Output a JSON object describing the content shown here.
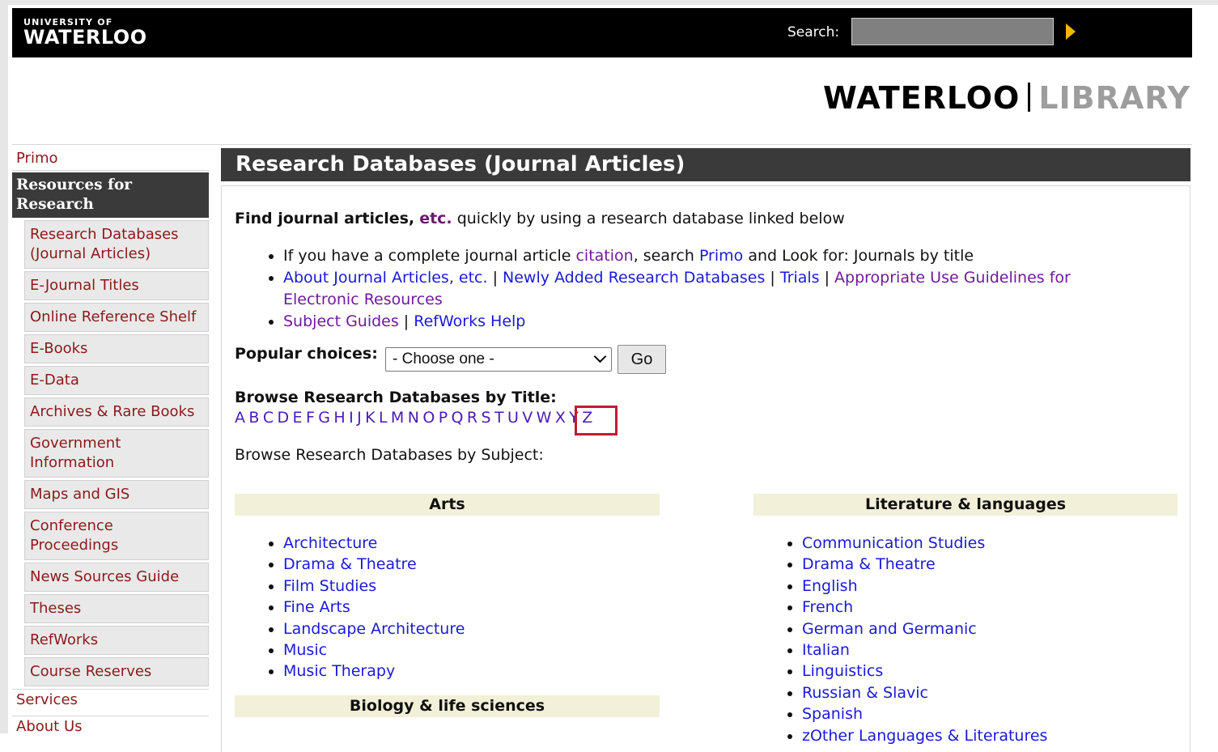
{
  "header": {
    "logo_small": "UNIVERSITY OF",
    "logo_big": "WATERLOO",
    "search_label": "Search:",
    "search_value": "",
    "brand_left": "WATERLOO",
    "brand_right": "LIBRARY"
  },
  "sidebar": {
    "top_link": "Primo",
    "current": "Resources for Research",
    "items": [
      "Research Databases (Journal Articles)",
      "E-Journal Titles",
      "Online Reference Shelf",
      "E-Books",
      "E-Data",
      "Archives & Rare Books",
      "Government Information",
      "Maps and GIS",
      "Conference Proceedings",
      "News Sources Guide",
      "Theses",
      "RefWorks",
      "Course Reserves"
    ],
    "bottom_links": [
      "Services",
      "About Us"
    ]
  },
  "main": {
    "title": "Research Databases (Journal Articles)",
    "intro_bold": "Find journal articles,",
    "intro_etc": "etc.",
    "intro_rest": " quickly by using a research database linked below",
    "bullet1": {
      "pre": "If you have a complete journal article ",
      "citation": "citation",
      "mid": ", search ",
      "primo": "Primo",
      "post": " and Look for: Journals by title"
    },
    "bullet2": {
      "about": "About Journal Articles, etc.",
      "sep": " | ",
      "newly": "Newly Added Research Databases",
      "trials": "Trials",
      "guidelines": "Appropriate Use Guidelines for Electronic Resources"
    },
    "bullet3": {
      "subject_guides": "Subject Guides",
      "sep": " | ",
      "refworks_help": "RefWorks Help"
    },
    "popular_label": "Popular choices:",
    "popular_selected": "- Choose one -",
    "go_label": "Go",
    "browse_title": "Browse Research Databases by Title:",
    "alphabet": [
      "A",
      "B",
      "C",
      "D",
      "E",
      "F",
      "G",
      "H",
      "I",
      "J",
      "K",
      "L",
      "M",
      "N",
      "O",
      "P",
      "Q",
      "R",
      "S",
      "T",
      "U",
      "V",
      "W",
      "X",
      "Y",
      "Z"
    ],
    "browse_subject": "Browse Research Databases by Subject:",
    "categories": {
      "arts": {
        "title": "Arts",
        "items": [
          "Architecture",
          "Drama & Theatre",
          "Film Studies",
          "Fine Arts",
          "Landscape Architecture",
          "Music",
          "Music Therapy"
        ]
      },
      "biology": {
        "title": "Biology & life sciences"
      },
      "literature": {
        "title": "Literature & languages",
        "items": [
          "Communication Studies",
          "Drama & Theatre",
          "English",
          "French",
          "German and Germanic",
          "Italian",
          "Linguistics",
          "Russian & Slavic",
          "Spanish",
          "zOther Languages & Literatures"
        ]
      }
    }
  },
  "colors": {
    "link": "#1a1ad9",
    "visited": "#6e1a9e",
    "sidebar_link": "#8b1a1a",
    "dark_bar": "#3a3a3a",
    "category_bg": "#f2f0d8",
    "highlight": "#c11b32",
    "search_arrow": "#f2b800"
  }
}
